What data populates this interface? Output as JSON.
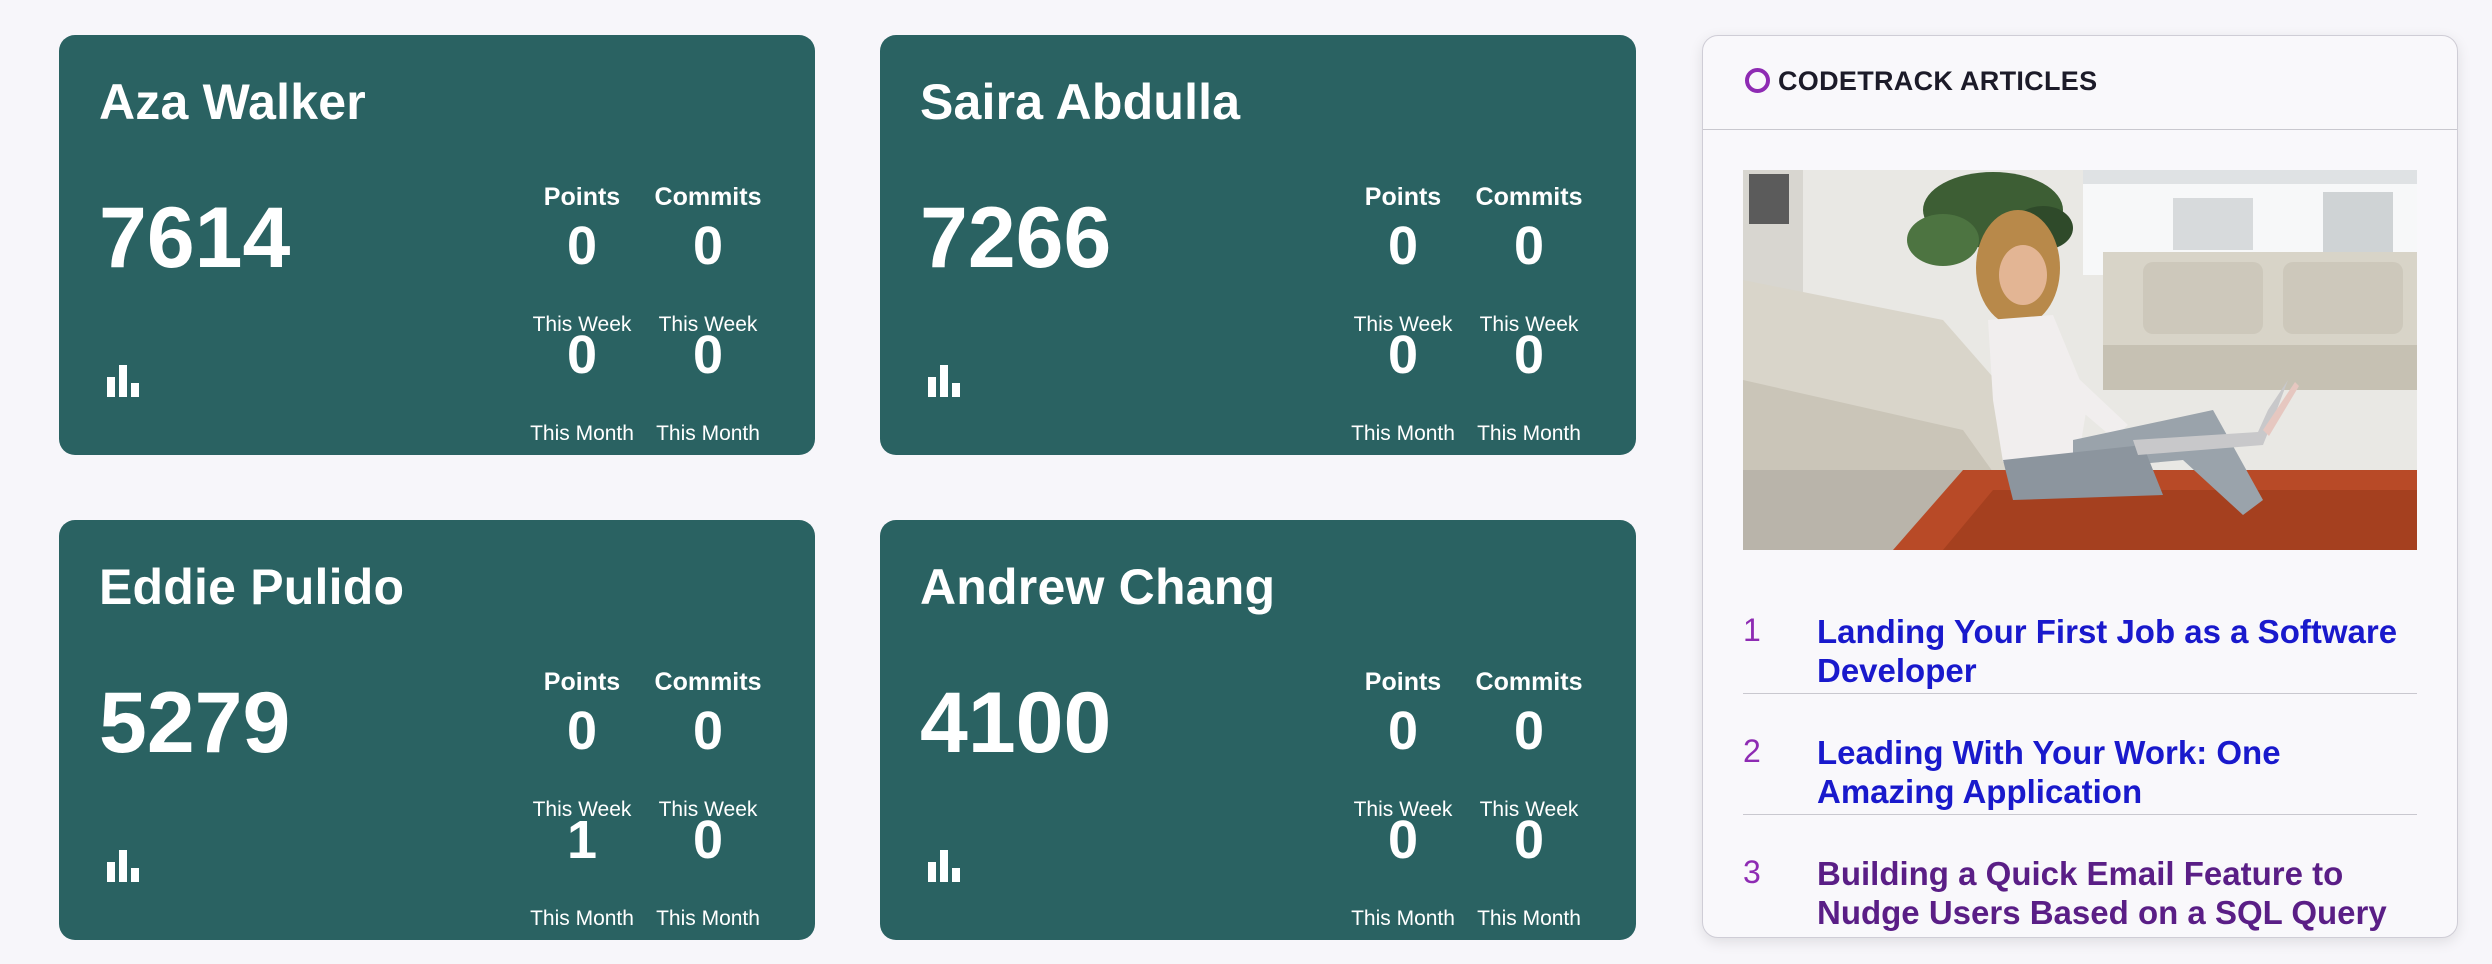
{
  "leaderboard": [
    {
      "name": "Aza Walker",
      "total": "7614",
      "points_label": "Points",
      "commits_label": "Commits",
      "points_week": "0",
      "commits_week": "0",
      "points_month": "0",
      "commits_month": "0",
      "week_label": "This Week",
      "month_label": "This Month"
    },
    {
      "name": "Saira Abdulla",
      "total": "7266",
      "points_label": "Points",
      "commits_label": "Commits",
      "points_week": "0",
      "commits_week": "0",
      "points_month": "0",
      "commits_month": "0",
      "week_label": "This Week",
      "month_label": "This Month"
    },
    {
      "name": "Eddie Pulido",
      "total": "5279",
      "points_label": "Points",
      "commits_label": "Commits",
      "points_week": "0",
      "commits_week": "0",
      "points_month": "1",
      "commits_month": "0",
      "week_label": "This Week",
      "month_label": "This Month"
    },
    {
      "name": "Andrew Chang",
      "total": "4100",
      "points_label": "Points",
      "commits_label": "Commits",
      "points_week": "0",
      "commits_week": "0",
      "points_month": "0",
      "commits_month": "0",
      "week_label": "This Week",
      "month_label": "This Month"
    }
  ],
  "icons": {
    "card_chart": "bar-chart-icon",
    "header_marker": "ring-icon"
  },
  "colors": {
    "card_bg": "#2a6262",
    "accent": "#8e2bb3",
    "link": "#1919cc",
    "link_visited": "#5a1e86"
  },
  "articles": {
    "title": "CODETRACK ARTICLES",
    "items": [
      {
        "num": "1",
        "title": "Landing Your First Job as a Software Developer"
      },
      {
        "num": "2",
        "title": "Leading With Your Work: One Amazing Application"
      },
      {
        "num": "3",
        "title": "Building a Quick Email Feature to Nudge Users Based on a SQL Query"
      }
    ]
  }
}
